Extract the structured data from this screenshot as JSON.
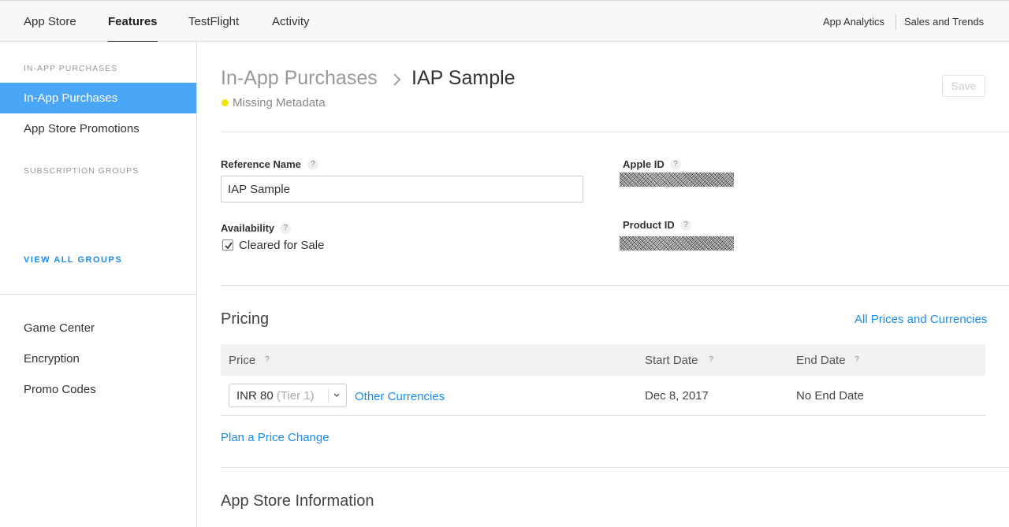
{
  "topnav": {
    "tabs": [
      "App Store",
      "Features",
      "TestFlight",
      "Activity"
    ],
    "active_tab": "Features",
    "right_links": [
      "App Analytics",
      "Sales and Trends"
    ]
  },
  "sidebar": {
    "iap_heading": "IN-APP PURCHASES",
    "iap_items": [
      "In-App Purchases",
      "App Store Promotions"
    ],
    "subscription_heading": "SUBSCRIPTION GROUPS",
    "view_all": "VIEW ALL GROUPS",
    "bottom_items": [
      "Game Center",
      "Encryption",
      "Promo Codes"
    ]
  },
  "header": {
    "breadcrumb_parent": "In-App Purchases",
    "title": "IAP Sample",
    "status": "Missing Metadata",
    "status_color": "#f5e600",
    "save_label": "Save"
  },
  "details": {
    "reference_name_label": "Reference Name",
    "reference_name_value": "IAP Sample",
    "availability_label": "Availability",
    "cleared_for_sale_label": "Cleared for Sale",
    "cleared_for_sale_checked": true,
    "apple_id_label": "Apple ID",
    "product_id_label": "Product ID",
    "help_glyph": "?"
  },
  "pricing": {
    "title": "Pricing",
    "all_prices_link": "All Prices and Currencies",
    "columns": [
      "Price",
      "Start Date",
      "End Date"
    ],
    "price_value": "INR 80",
    "price_tier": "(Tier 1)",
    "other_currencies_link": "Other Currencies",
    "start_date": "Dec 8, 2017",
    "end_date": "No End Date",
    "plan_change_link": "Plan a Price Change"
  },
  "app_store_information": {
    "title": "App Store Information"
  },
  "colors": {
    "accent": "#1a8cf0",
    "sidebar_active": "#4aa6f7"
  }
}
